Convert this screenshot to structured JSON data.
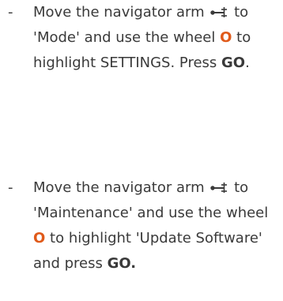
{
  "instructions": [
    {
      "bullet": "-",
      "parts": {
        "a": "Move the navigator arm",
        "icon": "navigator-arm-icon",
        "b": "to 'Mode' and use the wheel",
        "wheel_symbol": "O",
        "c": "to highlight SETTINGS. Press",
        "go": "GO",
        "end": "."
      }
    },
    {
      "bullet": "-",
      "parts": {
        "a": "Move the navigator arm",
        "icon": "navigator-arm-icon",
        "b": "to 'Maintenance' and use the wheel",
        "wheel_symbol": "O",
        "c": "to highlight 'Update Software' and press",
        "go_end": "GO."
      }
    }
  ],
  "colors": {
    "text": "#3a3a3a",
    "wheel_accent": "#e05a1a"
  }
}
